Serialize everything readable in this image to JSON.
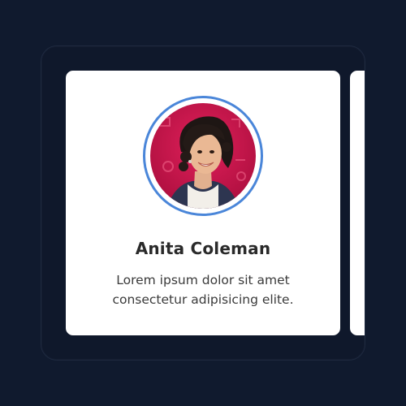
{
  "card": {
    "name": "Anita Coleman",
    "description_line1": "Lorem ipsum dolor sit amet",
    "description_line2": "consectetur adipisicing elite."
  },
  "colors": {
    "page_background": "#101a2e",
    "card_background": "#ffffff",
    "avatar_ring": "#4a86d9",
    "photo_background": "#c8134a"
  },
  "icons": {
    "avatar": "profile-photo"
  }
}
